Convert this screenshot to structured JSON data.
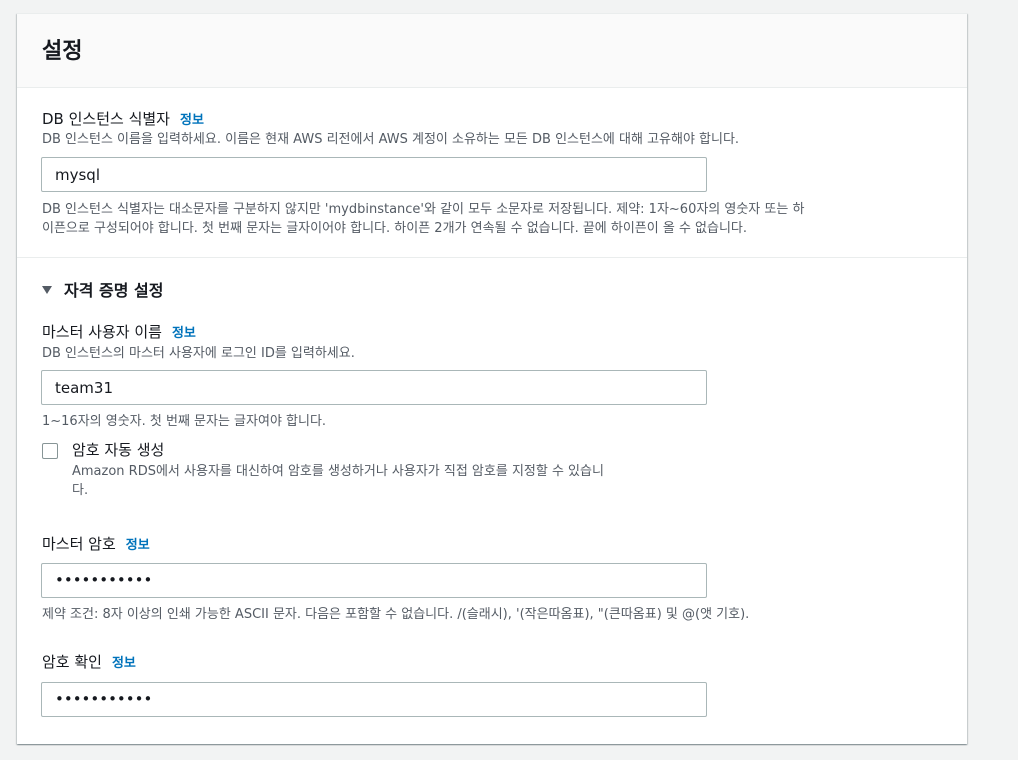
{
  "panel": {
    "title": "설정"
  },
  "db_identifier": {
    "label": "DB 인스턴스 식별자",
    "info": "정보",
    "description": "DB 인스턴스 이름을 입력하세요. 이름은 현재 AWS 리전에서 AWS 계정이 소유하는 모든 DB 인스턴스에 대해 고유해야 합니다.",
    "value": "mysql",
    "constraint_line1": "DB 인스턴스 식별자는 대소문자를 구분하지 않지만 'mydbinstance'와 같이 모두 소문자로 저장됩니다. 제약: 1자~60자의 영숫자 또는 하",
    "constraint_line2": "이픈으로 구성되어야 합니다. 첫 번째 문자는 글자이어야 합니다. 하이픈 2개가 연속될 수 없습니다. 끝에 하이픈이 올 수 없습니다."
  },
  "credentials": {
    "title": "자격 증명 설정",
    "expanded": true,
    "master_username": {
      "label": "마스터 사용자 이름",
      "info": "정보",
      "description": "DB 인스턴스의 마스터 사용자에 로그인 ID를 입력하세요.",
      "value": "team31",
      "constraint": "1~16자의 영숫자. 첫 번째 문자는 글자여야 합니다."
    },
    "auto_generate": {
      "label": "암호 자동 생성",
      "checked": false,
      "description_line1": "Amazon RDS에서 사용자를 대신하여 암호를 생성하거나 사용자가 직접 암호를 지정할 수 있습니",
      "description_line2": "다."
    },
    "master_password": {
      "label": "마스터 암호",
      "info": "정보",
      "value": "•••••••••••",
      "constraint": "제약 조건: 8자 이상의 인쇄 가능한 ASCII 문자. 다음은 포함할 수 없습니다. /(슬래시), '(작은따옴표), \"(큰따옴표) 및 @(앳 기호)."
    },
    "confirm_password": {
      "label": "암호 확인",
      "info": "정보",
      "value": "•••••••••••"
    }
  },
  "colors": {
    "link": "#0073bb",
    "text": "#16191f",
    "secondary_text": "#545b64",
    "input_border": "#aab7b8",
    "header_bg": "#fafafa",
    "page_bg": "#f2f3f3"
  }
}
